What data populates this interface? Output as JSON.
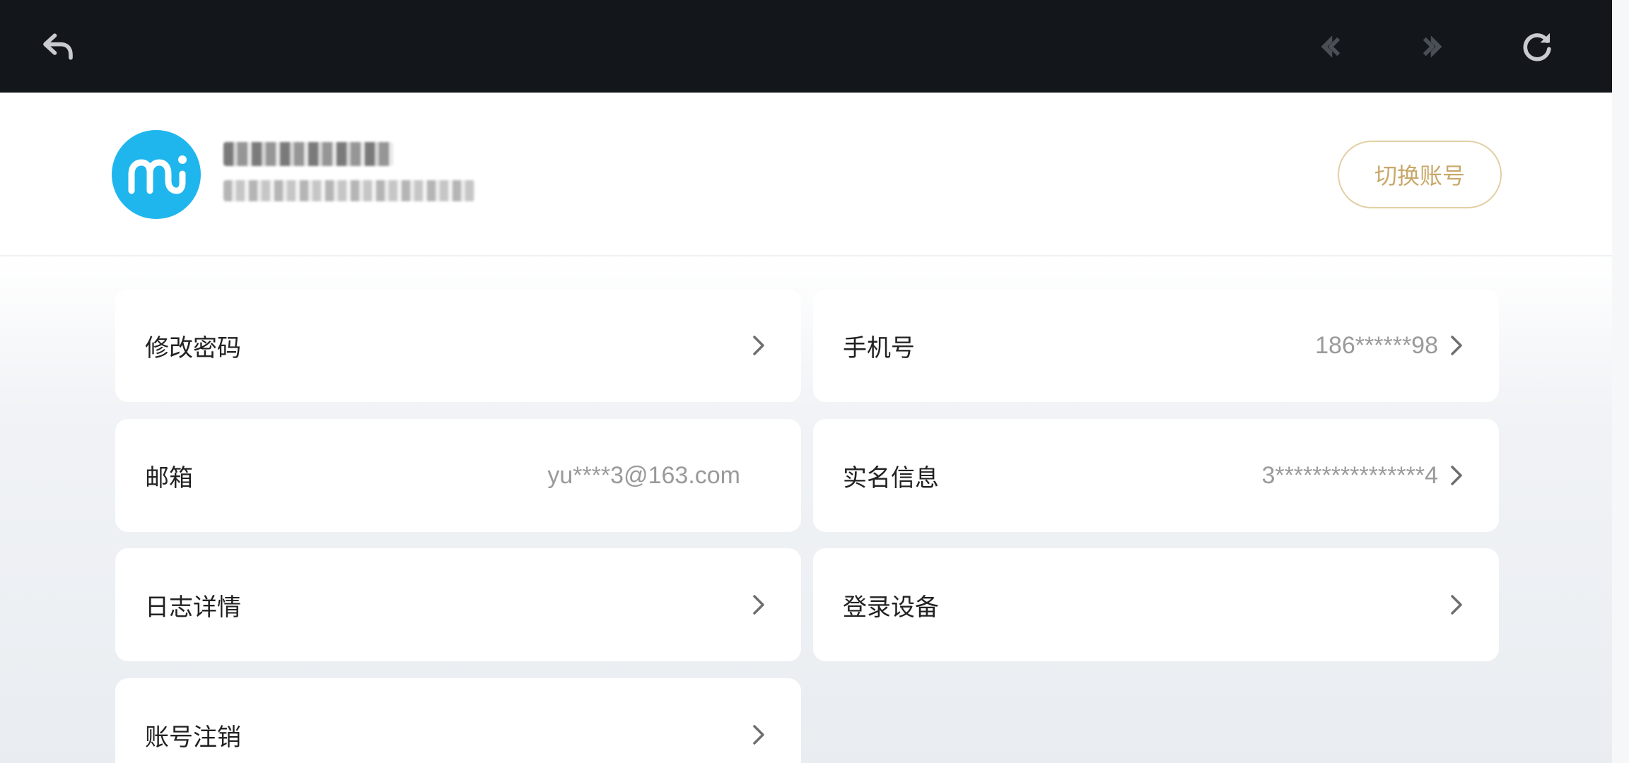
{
  "toolbar": {
    "icons": [
      "back-arrow-icon",
      "prev-page-icon",
      "next-page-icon",
      "refresh-icon"
    ]
  },
  "profile": {
    "name": "",
    "meta": "",
    "switch_account_label": "切换账号",
    "avatar_logo": "mi"
  },
  "settings": {
    "change_password": {
      "label": "修改密码",
      "value": ""
    },
    "phone": {
      "label": "手机号",
      "value": "186******98"
    },
    "email": {
      "label": "邮箱",
      "value": "yu****3@163.com"
    },
    "real_name": {
      "label": "实名信息",
      "value": "3****************4"
    },
    "log_details": {
      "label": "日志详情",
      "value": ""
    },
    "login_devices": {
      "label": "登录设备",
      "value": ""
    },
    "account_cancel": {
      "label": "账号注销",
      "value": ""
    }
  },
  "colors": {
    "topbar": "#13161b",
    "avatar": "#1fb6ee",
    "switch_border": "#e2cfa4",
    "switch_text": "#c9a86a",
    "value_text": "#9a9a9a"
  }
}
